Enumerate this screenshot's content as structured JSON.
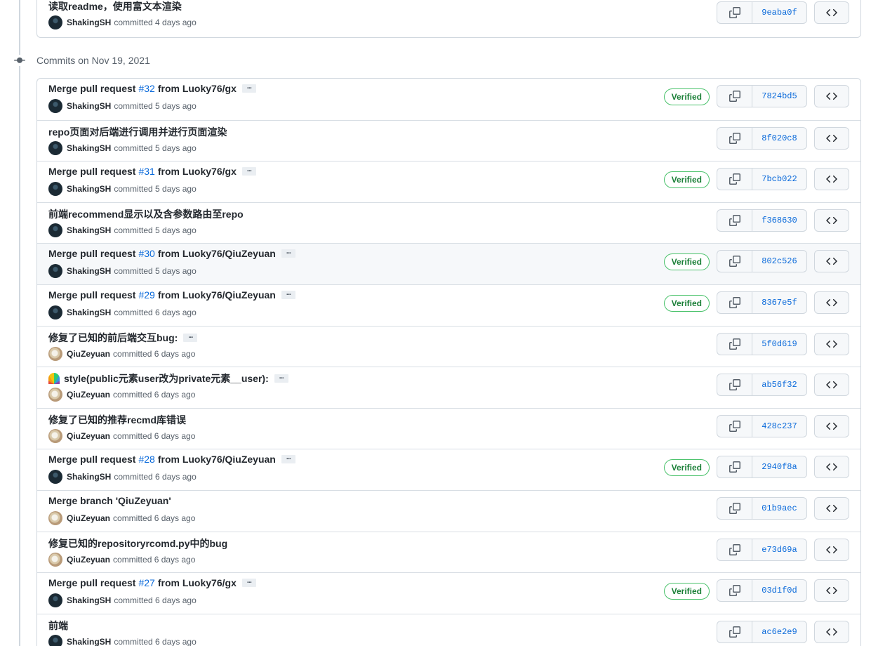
{
  "top_commit": {
    "title": "读取readme，使用富文本渲染",
    "author": "ShakingSH",
    "avatar": "shaking",
    "time_text": "committed 4 days ago",
    "verified": false,
    "sha": "9eaba0f"
  },
  "date_heading": "Commits on Nov 19, 2021",
  "verified_label": "Verified",
  "icons": {
    "copy": "copy-icon",
    "browse": "code-icon",
    "commit": "git-commit-icon",
    "emoji": "rainbow-emoji"
  },
  "commits": [
    {
      "title_pre": "Merge pull request",
      "pr": "#32",
      "title_post": "from Luoky76/gx",
      "has_more": true,
      "author": "ShakingSH",
      "avatar": "shaking",
      "time_text": "committed 5 days ago",
      "verified": true,
      "sha": "7824bd5"
    },
    {
      "title": "repo页面对后端进行调用并进行页面渲染",
      "has_more": false,
      "author": "ShakingSH",
      "avatar": "shaking",
      "time_text": "committed 5 days ago",
      "verified": false,
      "sha": "8f020c8"
    },
    {
      "title_pre": "Merge pull request",
      "pr": "#31",
      "title_post": "from Luoky76/gx",
      "has_more": true,
      "author": "ShakingSH",
      "avatar": "shaking",
      "time_text": "committed 5 days ago",
      "verified": true,
      "sha": "7bcb022"
    },
    {
      "title": "前端recommend显示以及含参数路由至repo",
      "has_more": false,
      "author": "ShakingSH",
      "avatar": "shaking",
      "time_text": "committed 5 days ago",
      "verified": false,
      "sha": "f368630"
    },
    {
      "title_pre": "Merge pull request",
      "pr": "#30",
      "title_post": "from Luoky76/QiuZeyuan",
      "has_more": true,
      "author": "ShakingSH",
      "avatar": "shaking",
      "time_text": "committed 5 days ago",
      "verified": true,
      "sha": "802c526",
      "highlight": true
    },
    {
      "title_pre": "Merge pull request",
      "pr": "#29",
      "title_post": "from Luoky76/QiuZeyuan",
      "has_more": true,
      "author": "ShakingSH",
      "avatar": "shaking",
      "time_text": "committed 6 days ago",
      "verified": true,
      "sha": "8367e5f"
    },
    {
      "title": "修复了已知的前后端交互bug:",
      "has_more": true,
      "author": "QiuZeyuan",
      "avatar": "qiu",
      "time_text": "committed 6 days ago",
      "verified": false,
      "sha": "5f0d619"
    },
    {
      "title": "style(public元素user改为private元素__user):",
      "emoji": true,
      "has_more": true,
      "author": "QiuZeyuan",
      "avatar": "qiu",
      "time_text": "committed 6 days ago",
      "verified": false,
      "sha": "ab56f32"
    },
    {
      "title": "修复了已知的推荐recmd库错误",
      "has_more": false,
      "author": "QiuZeyuan",
      "avatar": "qiu",
      "time_text": "committed 6 days ago",
      "verified": false,
      "sha": "428c237"
    },
    {
      "title_pre": "Merge pull request",
      "pr": "#28",
      "title_post": "from Luoky76/QiuZeyuan",
      "has_more": true,
      "author": "ShakingSH",
      "avatar": "shaking",
      "time_text": "committed 6 days ago",
      "verified": true,
      "sha": "2940f8a"
    },
    {
      "title": "Merge branch 'QiuZeyuan'",
      "has_more": false,
      "author": "QiuZeyuan",
      "avatar": "qiu",
      "time_text": "committed 6 days ago",
      "verified": false,
      "sha": "01b9aec"
    },
    {
      "title": "修复已知的repositoryrcomd.py中的bug",
      "has_more": false,
      "author": "QiuZeyuan",
      "avatar": "qiu",
      "time_text": "committed 6 days ago",
      "verified": false,
      "sha": "e73d69a"
    },
    {
      "title_pre": "Merge pull request",
      "pr": "#27",
      "title_post": "from Luoky76/gx",
      "has_more": true,
      "author": "ShakingSH",
      "avatar": "shaking",
      "time_text": "committed 6 days ago",
      "verified": true,
      "sha": "03d1f0d"
    },
    {
      "title": "前端",
      "has_more": false,
      "author": "ShakingSH",
      "avatar": "shaking",
      "time_text": "committed 6 days ago",
      "verified": false,
      "sha": "ac6e2e9"
    }
  ]
}
